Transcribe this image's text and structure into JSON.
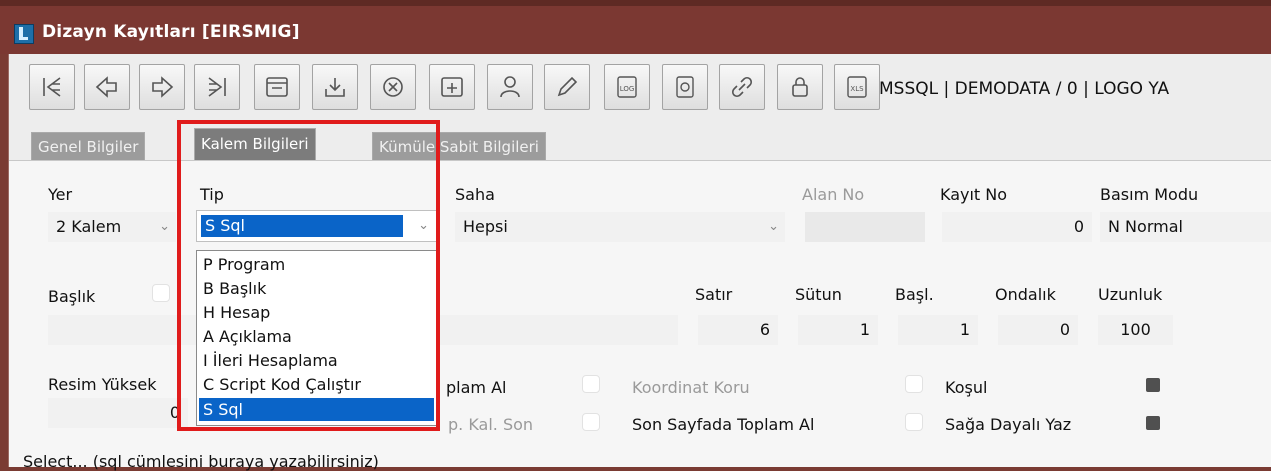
{
  "window": {
    "title": "Dizayn Kayıtları [EIRSMIG]"
  },
  "toolbar": {
    "buttons": [
      {
        "icon": "first-record-icon"
      },
      {
        "icon": "previous-record-icon"
      },
      {
        "icon": "next-record-icon"
      },
      {
        "icon": "last-record-icon"
      },
      {
        "icon": "window-icon"
      },
      {
        "icon": "download-icon"
      },
      {
        "icon": "close-circle-icon"
      },
      {
        "icon": "add-icon"
      },
      {
        "icon": "user-icon"
      },
      {
        "icon": "edit-pencil-icon"
      },
      {
        "icon": "log-icon"
      },
      {
        "icon": "document-icon"
      },
      {
        "icon": "link-icon"
      },
      {
        "icon": "lock-icon"
      },
      {
        "icon": "xls-icon"
      }
    ],
    "status": "MSSQL | DEMODATA / 0 | LOGO YA"
  },
  "tabs": [
    {
      "label": "Genel Bilgiler",
      "active": false
    },
    {
      "label": "Kalem Bilgileri",
      "active": true
    },
    {
      "label": "Kümüle Sabit Bilgileri",
      "active": false
    }
  ],
  "form": {
    "yer": {
      "label": "Yer",
      "value": "2 Kalem"
    },
    "tip": {
      "label": "Tip",
      "value": "S Sql"
    },
    "saha": {
      "label": "Saha",
      "value": "Hepsi"
    },
    "alan_no": {
      "label": "Alan No",
      "value": ""
    },
    "kayit_no": {
      "label": "Kayıt No",
      "value": "0"
    },
    "basim_modu": {
      "label": "Basım Modu",
      "value": "N Normal"
    },
    "baslik": {
      "label": "Başlık",
      "value": ""
    },
    "satir": {
      "label": "Satır",
      "value": "6"
    },
    "sutun": {
      "label": "Sütun",
      "value": "1"
    },
    "basl": {
      "label": "Başl.",
      "value": "1"
    },
    "ondalik": {
      "label": "Ondalık",
      "value": "0"
    },
    "uzunluk": {
      "label": "Uzunluk",
      "value": "100"
    },
    "resim_yuksek": {
      "label": "Resim Yüksek",
      "value": "0"
    },
    "checks": {
      "toplam_al": "plam Al",
      "koordinat_koru": "Koordinat Koru",
      "kosul": "Koşul",
      "kal_son": "p. Kal. Son",
      "son_sayfada_toplam_al": "Son Sayfada Toplam Al",
      "saga_dayali_yaz": "Sağa Dayalı Yaz"
    },
    "sql_hint": "Select... (sql cümlesini buraya yazabilirsiniz)"
  },
  "dropdown": {
    "options": [
      {
        "label": "P Program",
        "selected": false
      },
      {
        "label": "B Başlık",
        "selected": false
      },
      {
        "label": "H Hesap",
        "selected": false
      },
      {
        "label": "A Açıklama",
        "selected": false
      },
      {
        "label": "I İleri Hesaplama",
        "selected": false
      },
      {
        "label": "C Script Kod Çalıştır",
        "selected": false
      },
      {
        "label": "S Sql",
        "selected": true
      }
    ]
  },
  "colors": {
    "titlebar": "#7b3832",
    "selection": "#0a64c8",
    "annotation_border": "#e01b1b"
  }
}
